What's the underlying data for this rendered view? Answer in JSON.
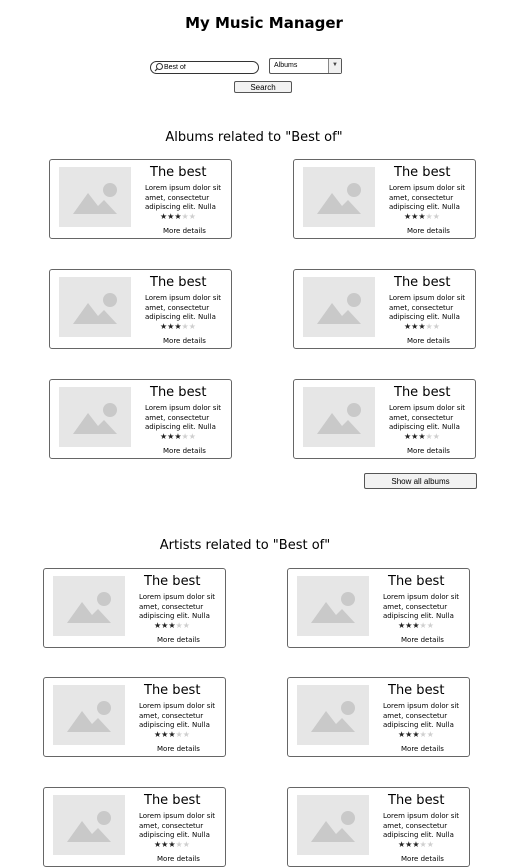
{
  "app": {
    "title": "My Music Manager"
  },
  "search": {
    "value": "Best of",
    "category": "Albums",
    "button_label": "Search"
  },
  "albums": {
    "heading": "Albums related to \"Best of\"",
    "show_all_label": "Show all albums",
    "items": [
      {
        "title": "The best",
        "description": "Lorem ipsum dolor sit amet, consectetur adipiscing elit. Nulla",
        "rating": 3,
        "more_label": "More details"
      },
      {
        "title": "The best",
        "description": "Lorem ipsum dolor sit amet, consectetur adipiscing elit. Nulla",
        "rating": 3,
        "more_label": "More details"
      },
      {
        "title": "The best",
        "description": "Lorem ipsum dolor sit amet, consectetur adipiscing elit. Nulla",
        "rating": 3,
        "more_label": "More details"
      },
      {
        "title": "The best",
        "description": "Lorem ipsum dolor sit amet, consectetur adipiscing elit. Nulla",
        "rating": 3,
        "more_label": "More details"
      },
      {
        "title": "The best",
        "description": "Lorem ipsum dolor sit amet, consectetur adipiscing elit. Nulla",
        "rating": 3,
        "more_label": "More details"
      },
      {
        "title": "The best",
        "description": "Lorem ipsum dolor sit amet, consectetur adipiscing elit. Nulla",
        "rating": 3,
        "more_label": "More details"
      }
    ]
  },
  "artists": {
    "heading": "Artists related to \"Best of\"",
    "items": [
      {
        "title": "The best",
        "description": "Lorem ipsum dolor sit amet, consectetur adipiscing elit. Nulla",
        "rating": 3,
        "more_label": "More details"
      },
      {
        "title": "The best",
        "description": "Lorem ipsum dolor sit amet, consectetur adipiscing elit. Nulla",
        "rating": 3,
        "more_label": "More details"
      },
      {
        "title": "The best",
        "description": "Lorem ipsum dolor sit amet, consectetur adipiscing elit. Nulla",
        "rating": 3,
        "more_label": "More details"
      },
      {
        "title": "The best",
        "description": "Lorem ipsum dolor sit amet, consectetur adipiscing elit. Nulla",
        "rating": 3,
        "more_label": "More details"
      },
      {
        "title": "The best",
        "description": "Lorem ipsum dolor sit amet, consectetur adipiscing elit. Nulla",
        "rating": 3,
        "more_label": "More details"
      },
      {
        "title": "The best",
        "description": "Lorem ipsum dolor sit amet, consectetur adipiscing elit. Nulla",
        "rating": 3,
        "more_label": "More details"
      }
    ]
  },
  "icons": {
    "search": "search-icon",
    "dropdown": "chevron-down-icon",
    "placeholder": "image-placeholder-icon"
  }
}
